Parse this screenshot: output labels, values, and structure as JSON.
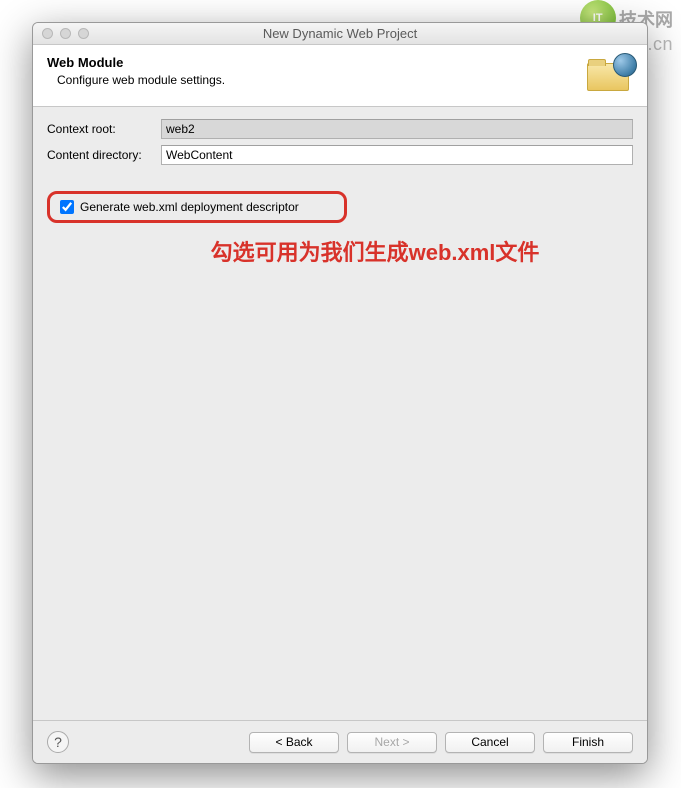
{
  "window": {
    "title": "New Dynamic Web Project"
  },
  "header": {
    "title": "Web Module",
    "subtitle": "Configure web module settings."
  },
  "form": {
    "context_root_label": "Context root:",
    "context_root_value": "web2",
    "content_dir_label": "Content directory:",
    "content_dir_value": "WebContent",
    "generate_dd_label": "Generate web.xml deployment descriptor",
    "generate_dd_checked": true
  },
  "annotation": "勾选可用为我们生成web.xml文件",
  "buttons": {
    "back": "< Back",
    "next": "Next >",
    "cancel": "Cancel",
    "finish": "Finish"
  },
  "watermark": {
    "badge": "IT",
    "cn": "技术网",
    "url": "www.itjs.cn"
  }
}
